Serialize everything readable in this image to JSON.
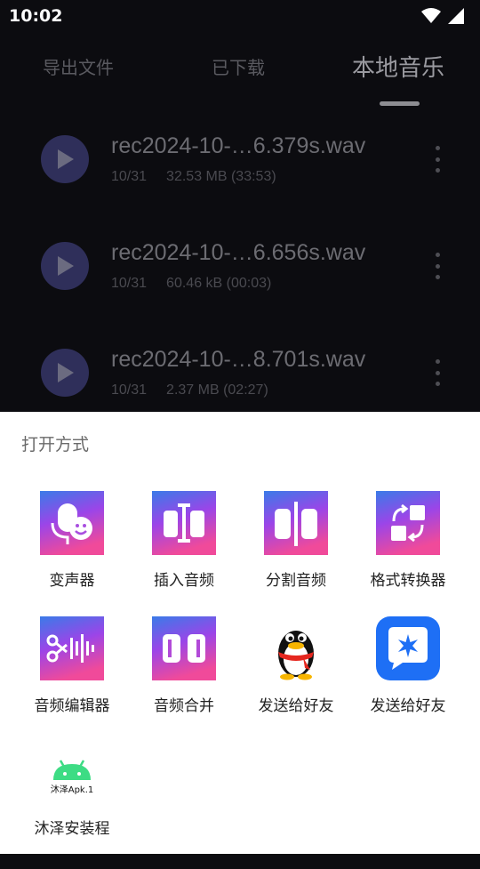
{
  "status_bar": {
    "time": "10:02"
  },
  "tabs": [
    {
      "label": "导出文件",
      "active": false
    },
    {
      "label": "已下载",
      "active": false
    },
    {
      "label": "本地音乐",
      "active": true
    }
  ],
  "files": [
    {
      "name": "rec2024-10-…6.379s.wav",
      "date": "10/31",
      "size": "32.53 MB (33:53)"
    },
    {
      "name": "rec2024-10-…6.656s.wav",
      "date": "10/31",
      "size": "60.46 kB (00:03)"
    },
    {
      "name": "rec2024-10-…8.701s.wav",
      "date": "10/31",
      "size": "2.37 MB (02:27)"
    }
  ],
  "sheet": {
    "title": "打开方式",
    "apps": [
      {
        "label": "变声器",
        "icon": "voice-changer-icon"
      },
      {
        "label": "插入音频",
        "icon": "insert-audio-icon"
      },
      {
        "label": "分割音频",
        "icon": "split-audio-icon"
      },
      {
        "label": "格式转换器",
        "icon": "format-converter-icon"
      },
      {
        "label": "音频编辑器",
        "icon": "audio-editor-icon"
      },
      {
        "label": "音频合并",
        "icon": "audio-merge-icon"
      },
      {
        "label": "发送给好友",
        "icon": "qq-penguin-icon"
      },
      {
        "label": "发送给好友",
        "icon": "tim-star-icon"
      },
      {
        "label": "沐泽安装程",
        "icon": "android-robot-icon",
        "icon_text": "沐泽Apk.1"
      }
    ]
  },
  "colors": {
    "gradient_top": "#3a7be8",
    "gradient_mid": "#9b45e8",
    "gradient_bottom": "#f04a9a",
    "tim_blue": "#1e6ff5",
    "android_green": "#3ddc84"
  }
}
